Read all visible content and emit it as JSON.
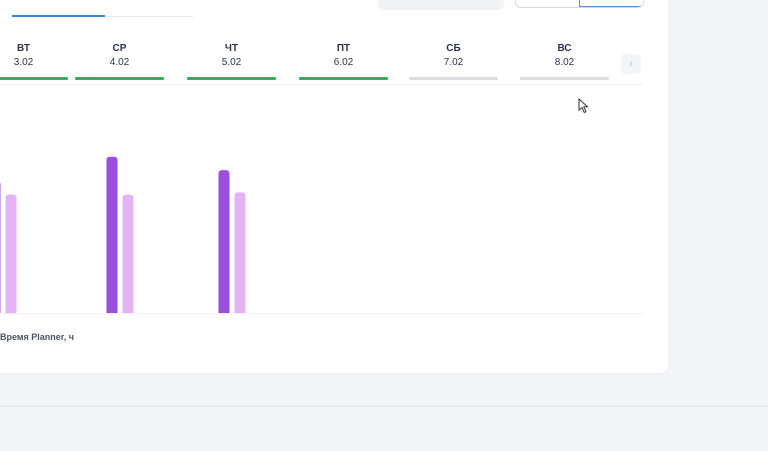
{
  "week": [
    {
      "name": "ВТ",
      "date": "3.02",
      "status_color": "#2db35d"
    },
    {
      "name": "СР",
      "date": "4.02",
      "status_color": "#2db35d"
    },
    {
      "name": "ЧТ",
      "date": "5.02",
      "status_color": "#2db35d"
    },
    {
      "name": "ПТ",
      "date": "6.02",
      "status_color": "#2db35d"
    },
    {
      "name": "СБ",
      "date": "7.02",
      "status_color": "#dcdde0"
    },
    {
      "name": "ВС",
      "date": "8.02",
      "status_color": "#dcdde0"
    }
  ],
  "next_button_label": "›",
  "legend": {
    "label": "Время Planner, ч"
  },
  "colors": {
    "primary_bar": "#9b4de0",
    "secondary_bar": "#e2b3f5"
  },
  "chart_data": {
    "type": "bar",
    "categories": [
      "ВТ",
      "СР",
      "ЧТ",
      "ПТ",
      "СБ",
      "ВС"
    ],
    "series": [
      {
        "values": [
          5.9,
          7.0,
          6.4,
          0,
          0,
          0
        ]
      },
      {
        "values": [
          5.3,
          5.3,
          5.4,
          0,
          0,
          0
        ]
      }
    ],
    "ylim": [
      0,
      7.3
    ]
  }
}
